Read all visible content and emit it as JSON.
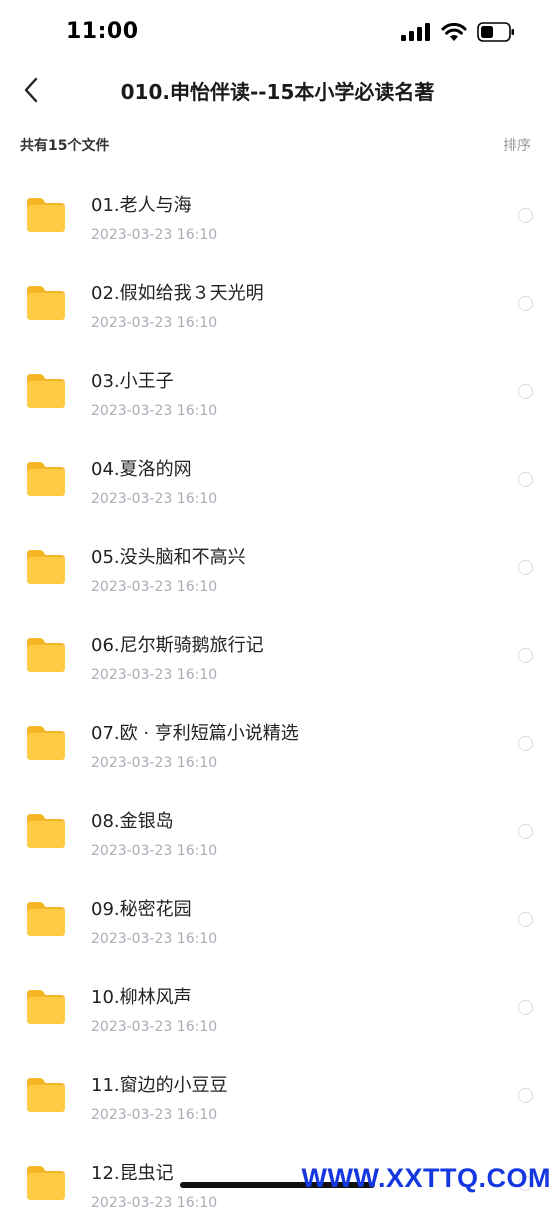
{
  "status_bar": {
    "time": "11:00"
  },
  "header": {
    "title": "010.申怡伴读--15本小学必读名著"
  },
  "summary": {
    "count_label": "共有15个文件",
    "sort_label": "排序"
  },
  "files": [
    {
      "name": "01.老人与海",
      "date": "2023-03-23 16:10"
    },
    {
      "name": "02.假如给我３天光明",
      "date": "2023-03-23 16:10"
    },
    {
      "name": "03.小王子",
      "date": "2023-03-23 16:10"
    },
    {
      "name": "04.夏洛的网",
      "date": "2023-03-23 16:10"
    },
    {
      "name": "05.没头脑和不高兴",
      "date": "2023-03-23 16:10"
    },
    {
      "name": "06.尼尔斯骑鹅旅行记",
      "date": "2023-03-23 16:10"
    },
    {
      "name": "07.欧 · 亨利短篇小说精选",
      "date": "2023-03-23 16:10"
    },
    {
      "name": "08.金银岛",
      "date": "2023-03-23 16:10"
    },
    {
      "name": "09.秘密花园",
      "date": "2023-03-23 16:10"
    },
    {
      "name": "10.柳林风声",
      "date": "2023-03-23 16:10"
    },
    {
      "name": "11.窗边的小豆豆",
      "date": "2023-03-23 16:10"
    },
    {
      "name": "12.昆虫记",
      "date": "2023-03-23 16:10"
    }
  ],
  "watermark": "WWW.XXTTQ.COM",
  "icons": {
    "back": "chevron-left-icon",
    "folder": "folder-icon",
    "signal": "cellular-signal-icon",
    "wifi": "wifi-icon",
    "battery": "battery-icon"
  },
  "colors": {
    "folder_yellow": "#FFC53D",
    "date_gray": "#A8ADB6",
    "watermark_blue": "#1437E0"
  }
}
